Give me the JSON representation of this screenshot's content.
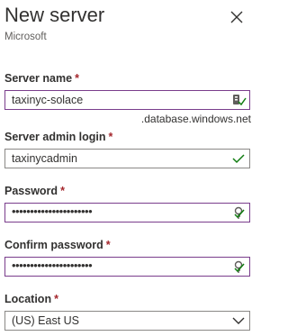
{
  "panel": {
    "title": "New server",
    "subtitle": "Microsoft"
  },
  "fields": {
    "server_name": {
      "label": "Server name",
      "required": "*",
      "value": "taxinyc-solace",
      "suffix": ".database.windows.net"
    },
    "admin_login": {
      "label": "Server admin login",
      "required": "*",
      "value": "taxinycadmin"
    },
    "password": {
      "label": "Password",
      "required": "*",
      "value": "••••••••••••••••••••••"
    },
    "confirm_password": {
      "label": "Confirm password",
      "required": "*",
      "value": "••••••••••••••••••••••"
    },
    "location": {
      "label": "Location",
      "required": "*",
      "value": "(US) East US"
    }
  },
  "icons": {
    "close": "close-icon",
    "valid": "checkmark-icon",
    "key": "key-icon",
    "dropdown": "chevron-down-icon"
  },
  "colors": {
    "accent": "#7a3d8c",
    "valid": "#107c10",
    "required": "#a4262c"
  }
}
